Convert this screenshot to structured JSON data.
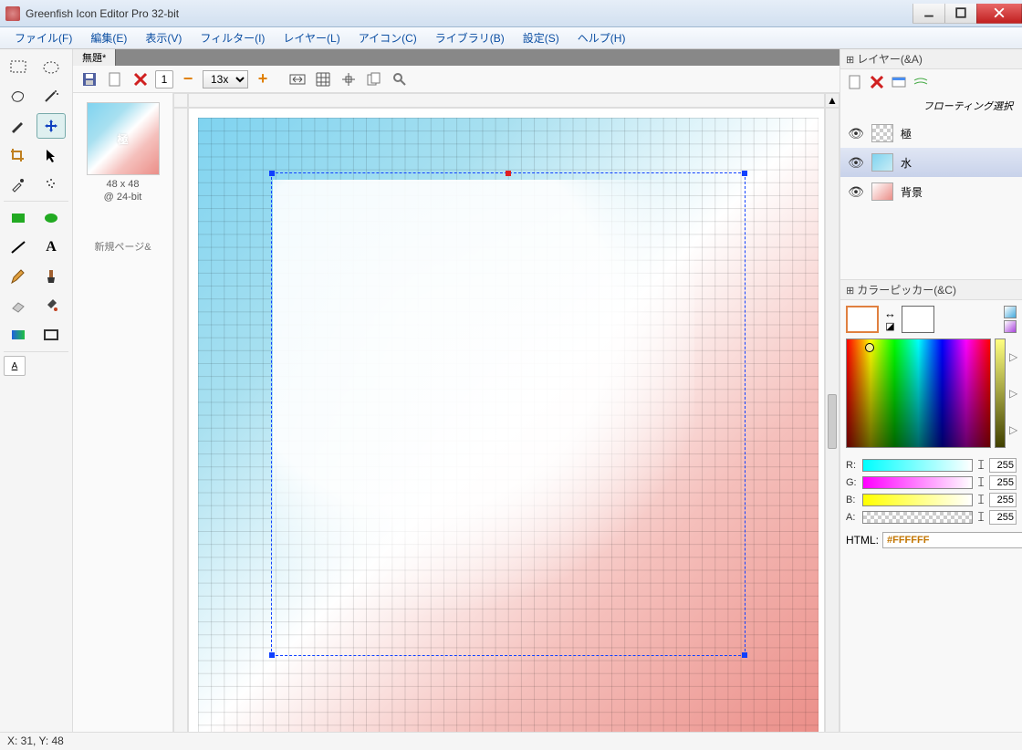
{
  "app_title": "Greenfish Icon Editor Pro 32-bit",
  "menu": [
    "ファイル(F)",
    "編集(E)",
    "表示(V)",
    "フィルター(I)",
    "レイヤー(L)",
    "アイコン(C)",
    "ライブラリ(B)",
    "設定(S)",
    "ヘルプ(H)"
  ],
  "doc": {
    "tab": "無題*",
    "zoom": "13x",
    "frame_number": "1",
    "thumb_label1": "48 x 48",
    "thumb_label2": "@ 24-bit",
    "thumb_glyph": "極",
    "new_page_hint": "新規ページ&"
  },
  "layers_panel": {
    "title": "レイヤー(&A)",
    "floating_label": "フローティング選択",
    "layers": [
      {
        "name": "極"
      },
      {
        "name": "水"
      },
      {
        "name": "背景"
      }
    ]
  },
  "picker_panel": {
    "title": "カラーピッカー(&C)",
    "r_label": "R:",
    "g_label": "G:",
    "b_label": "B:",
    "a_label": "A:",
    "r": "255",
    "g": "255",
    "b": "255",
    "a": "255",
    "html_label": "HTML:",
    "html_value": "#FFFFFF"
  },
  "status": "X: 31, Y: 48"
}
